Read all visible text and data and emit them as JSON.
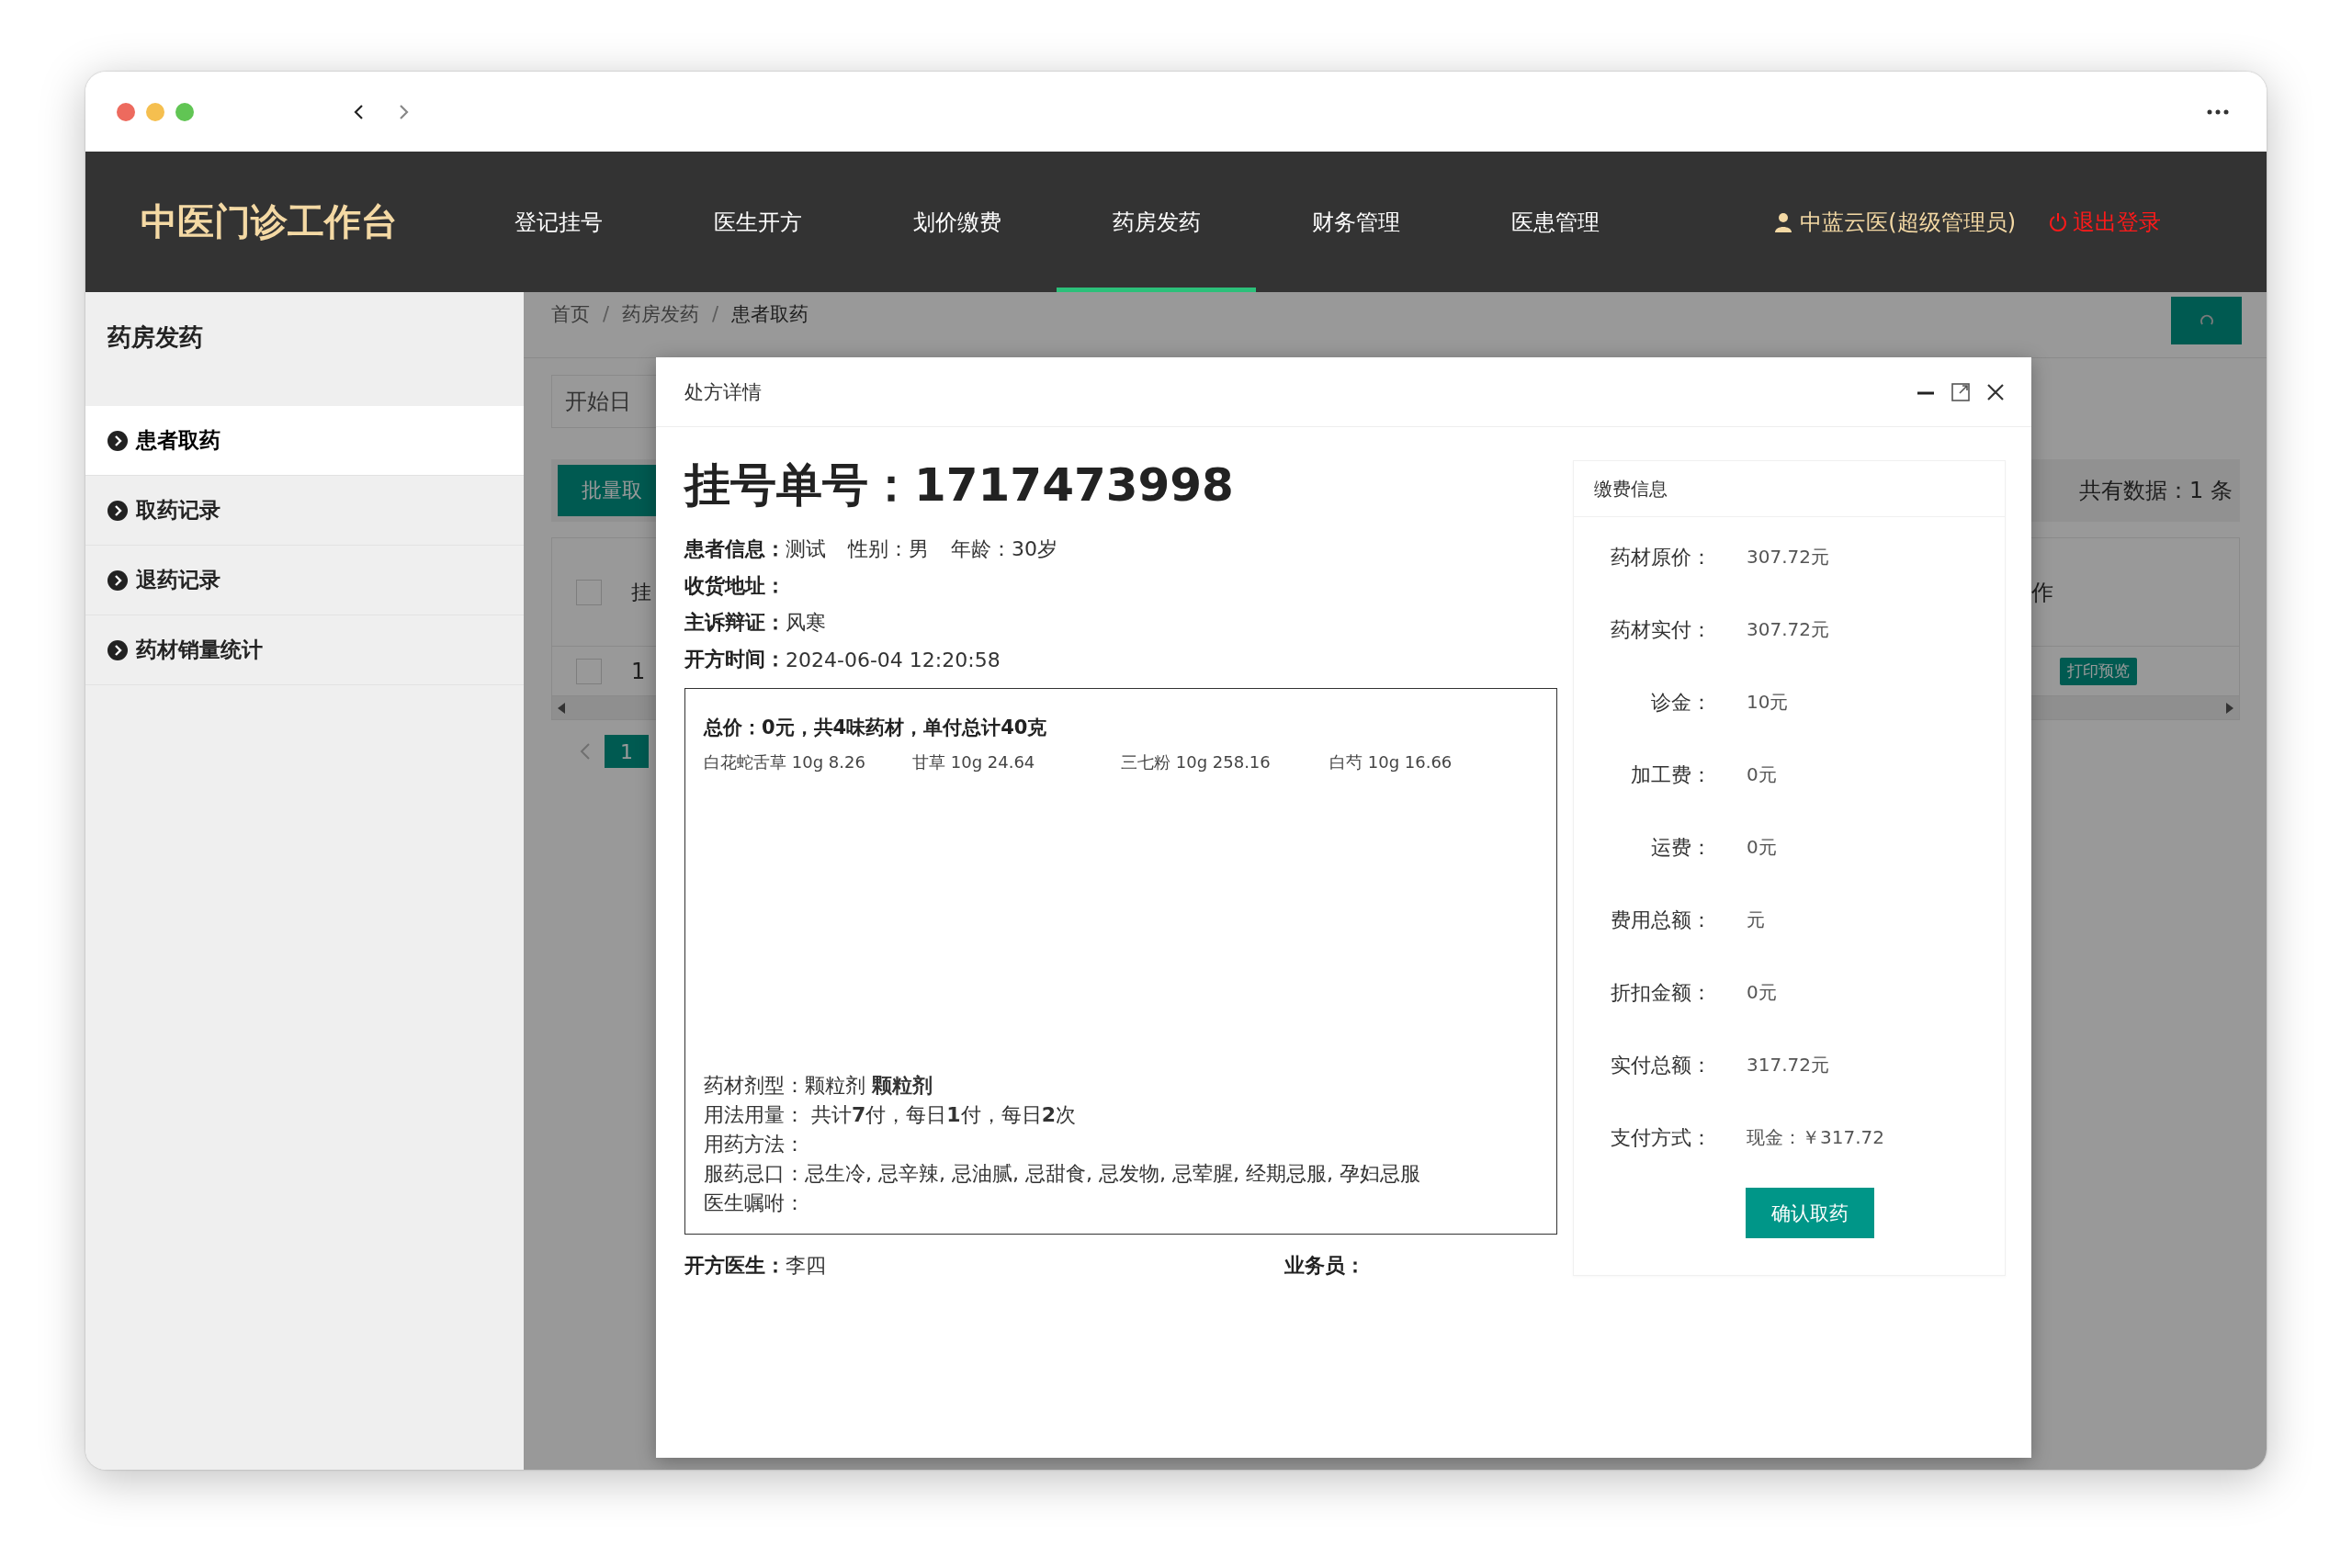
{
  "browser": {
    "traffic_lights": [
      {
        "color": "#ed6a5e"
      },
      {
        "color": "#f5bf4f"
      },
      {
        "color": "#61c554"
      }
    ]
  },
  "app": {
    "logo": "中医门诊工作台",
    "nav": [
      {
        "label": "登记挂号",
        "selected": false
      },
      {
        "label": "医生开方",
        "selected": false
      },
      {
        "label": "划价缴费",
        "selected": false
      },
      {
        "label": "药房发药",
        "selected": true
      },
      {
        "label": "财务管理",
        "selected": false
      },
      {
        "label": "医患管理",
        "selected": false
      }
    ],
    "user": "中蓝云医(超级管理员)",
    "logout": "退出登录"
  },
  "sidebar": {
    "title": "药房发药",
    "items": [
      {
        "label": "患者取药",
        "selected": true
      },
      {
        "label": "取药记录",
        "selected": false
      },
      {
        "label": "退药记录",
        "selected": false
      },
      {
        "label": "药材销量统计",
        "selected": false
      }
    ]
  },
  "content": {
    "breadcrumb": [
      {
        "kind": "link",
        "text": "首页"
      },
      {
        "kind": "separator",
        "text": "/"
      },
      {
        "kind": "link",
        "text": "药房发药"
      },
      {
        "kind": "separator",
        "text": "/"
      },
      {
        "kind": "current",
        "text": "患者取药"
      }
    ],
    "date_field": {
      "placeholder": "开始日"
    },
    "batch_button": "批量取",
    "total": "共有数据：1 条",
    "table": {
      "header_checked": false,
      "columns": [
        "挂",
        "作"
      ],
      "rows": [
        {
          "checked": false,
          "cells": [
            "1"
          ],
          "action": "打印预览"
        }
      ]
    },
    "pagination": {
      "pages": [
        {
          "label": "1",
          "selected": true
        }
      ]
    }
  },
  "modal": {
    "title": "处方详情",
    "heading": "挂号单号：1717473998",
    "info": [
      {
        "label": "患者信息：",
        "values": [
          "测试",
          "性别：男",
          "年龄：30岁"
        ]
      },
      {
        "label": "收货地址："
      },
      {
        "label": "主诉辩证：",
        "values": [
          "风寒"
        ]
      },
      {
        "label": "开方时间：",
        "values": [
          "2024-06-04 12:20:58"
        ]
      }
    ],
    "prescription": {
      "summary": "总价：0元，共4味药材，单付总计40克",
      "herbs": [
        "白花蛇舌草 10g 8.26",
        "甘草 10g 24.64",
        "三七粉 10g 258.16",
        "白芍 10g 16.66"
      ],
      "details": [
        "药材剂型：颗粒剂 **颗粒剂**",
        "用法用量： 共计**7**付，每日**1**付，每日**2**次",
        "用药方法：",
        "服药忌口：忌生冷, 忌辛辣, 忌油腻, 忌甜食, 忌发物, 忌荤腥, 经期忌服, 孕妇忌服",
        "医生嘱咐："
      ]
    },
    "doctor": {
      "label": "开方医生：",
      "value": "李四"
    },
    "clerk": {
      "label": "业务员："
    },
    "payment": {
      "title": "缴费信息",
      "rows": [
        {
          "label": "药材原价：",
          "value": "307.72元"
        },
        {
          "label": "药材实付：",
          "value": "307.72元"
        },
        {
          "label": "诊金：",
          "value": "10元"
        },
        {
          "label": "加工费：",
          "value": "0元"
        },
        {
          "label": "运费：",
          "value": "0元"
        },
        {
          "label": "费用总额：",
          "value": "元"
        },
        {
          "label": "折扣金额：",
          "value": "0元"
        },
        {
          "label": "实付总额：",
          "value": "317.72元"
        },
        {
          "label": "支付方式：",
          "value": "现金：￥317.72"
        }
      ],
      "button": "确认取药"
    }
  }
}
